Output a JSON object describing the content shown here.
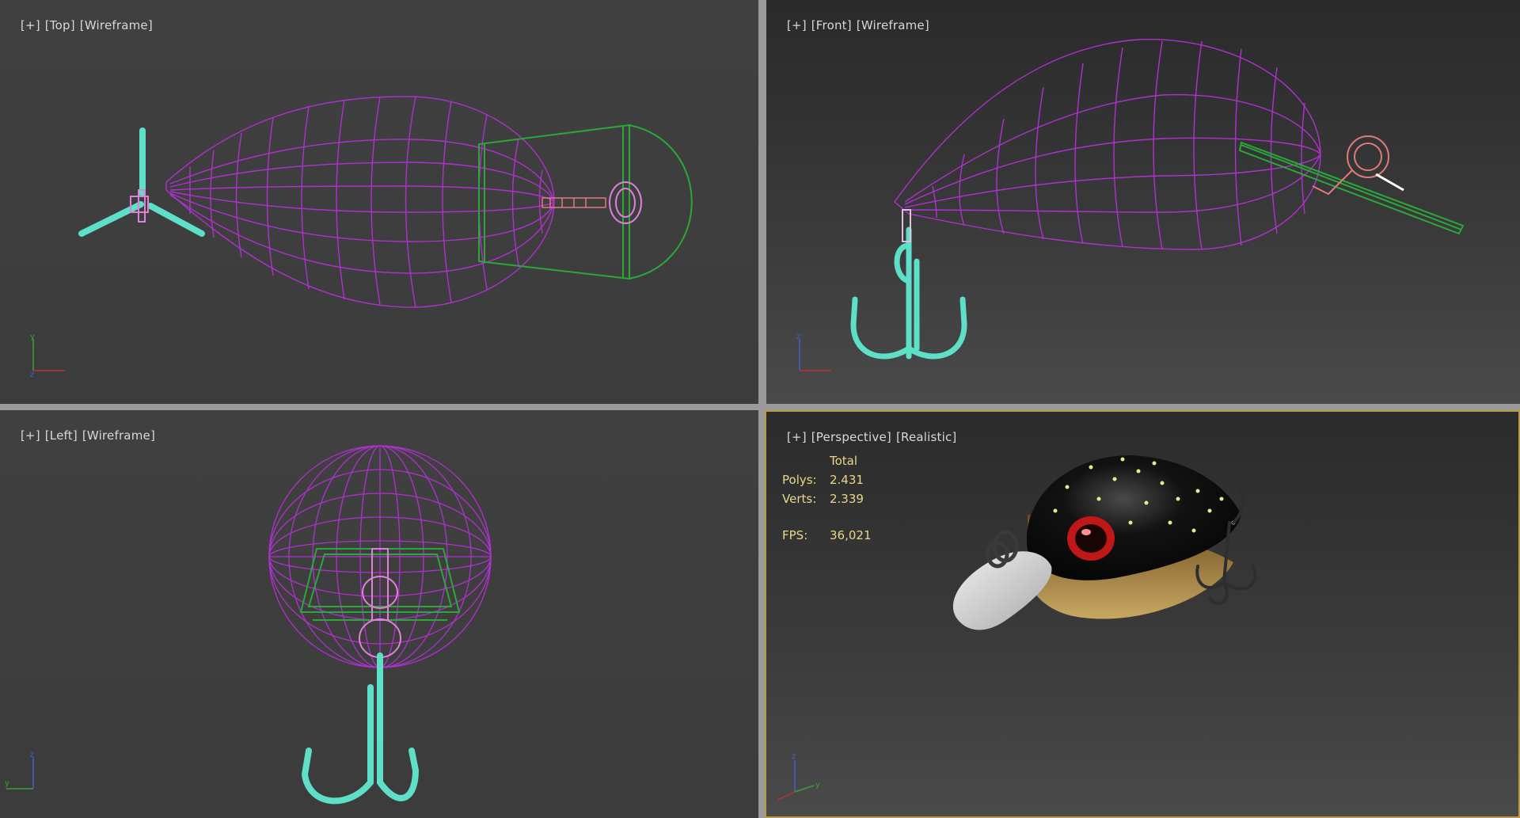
{
  "viewports": {
    "top": {
      "plus": "[+]",
      "view": "[Top]",
      "shading": "[Wireframe]"
    },
    "front": {
      "plus": "[+]",
      "view": "[Front]",
      "shading": "[Wireframe]"
    },
    "left": {
      "plus": "[+]",
      "view": "[Left]",
      "shading": "[Wireframe]"
    },
    "perspective": {
      "plus": "[+]",
      "view": "[Perspective]",
      "shading": "[Realistic]"
    }
  },
  "stats": {
    "header": "Total",
    "polys_label": "Polys:",
    "polys_value": "2.431",
    "verts_label": "Verts:",
    "verts_value": "2.339",
    "fps_label": "FPS:",
    "fps_value": "36,021"
  },
  "colors": {
    "body_wire": "#b030d0",
    "lip_wire": "#2aa83a",
    "hook": "#5ee0c8",
    "ring": "#e07a7a",
    "active_border": "#b89a48"
  },
  "icons": [
    "axis-gizmo-icon"
  ]
}
